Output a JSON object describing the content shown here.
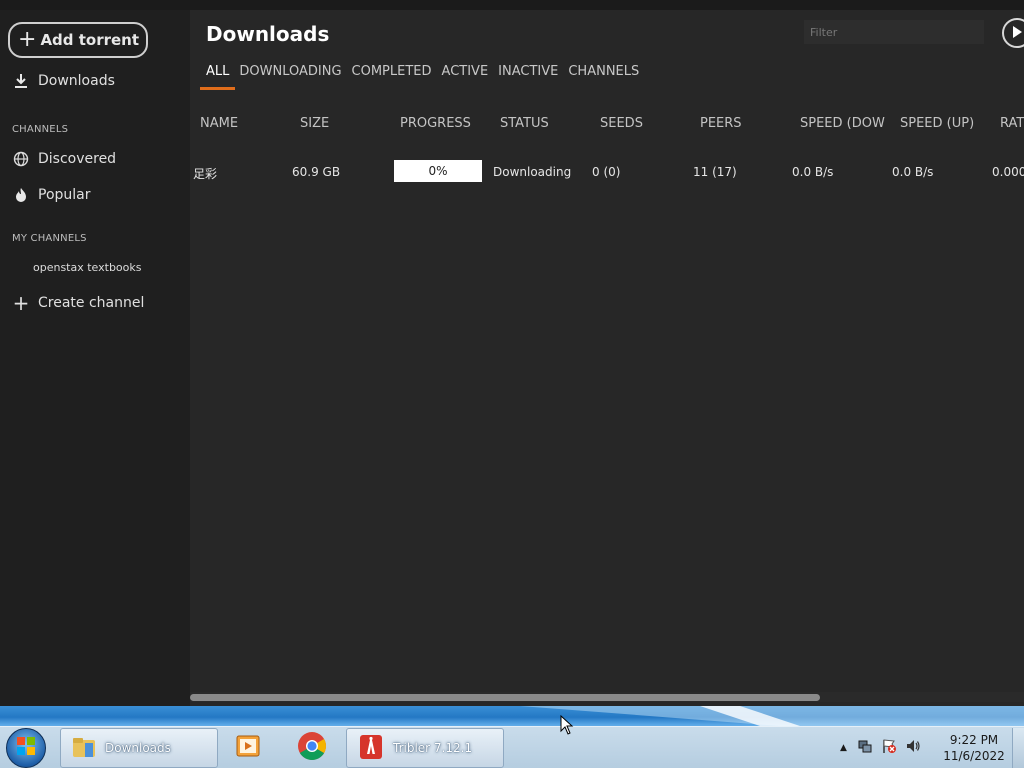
{
  "sidebar": {
    "add_torrent_label": "Add torrent",
    "downloads_label": "Downloads",
    "channels_heading": "CHANNELS",
    "discovered_label": "Discovered",
    "popular_label": "Popular",
    "my_channels_heading": "MY CHANNELS",
    "my_channels": [
      "openstax textbooks"
    ],
    "create_channel_label": "Create channel"
  },
  "header": {
    "title": "Downloads",
    "filter_placeholder": "Filter"
  },
  "tabs": [
    {
      "label": "ALL",
      "active": true
    },
    {
      "label": "DOWNLOADING",
      "active": false
    },
    {
      "label": "COMPLETED",
      "active": false
    },
    {
      "label": "ACTIVE",
      "active": false
    },
    {
      "label": "INACTIVE",
      "active": false
    },
    {
      "label": "CHANNELS",
      "active": false
    }
  ],
  "table": {
    "columns": [
      "NAME",
      "SIZE",
      "PROGRESS",
      "STATUS",
      "SEEDS",
      "PEERS",
      "SPEED (DOW",
      "SPEED (UP)",
      "RAT"
    ],
    "rows": [
      {
        "name": "足彩",
        "size": "60.9 GB",
        "progress": "0%",
        "status": "Downloading",
        "seeds": "0 (0)",
        "peers": "11 (17)",
        "speed_down": "0.0 B/s",
        "speed_up": "0.0 B/s",
        "ratio": "0.000"
      }
    ]
  },
  "taskbar": {
    "explorer_label": "Downloads",
    "tribler_label": "Tribler 7.12.1",
    "time": "9:22 PM",
    "date": "11/6/2022"
  },
  "colors": {
    "accent": "#e06d1b",
    "sidebar_bg": "#1f1f1f",
    "main_bg": "#272727"
  }
}
